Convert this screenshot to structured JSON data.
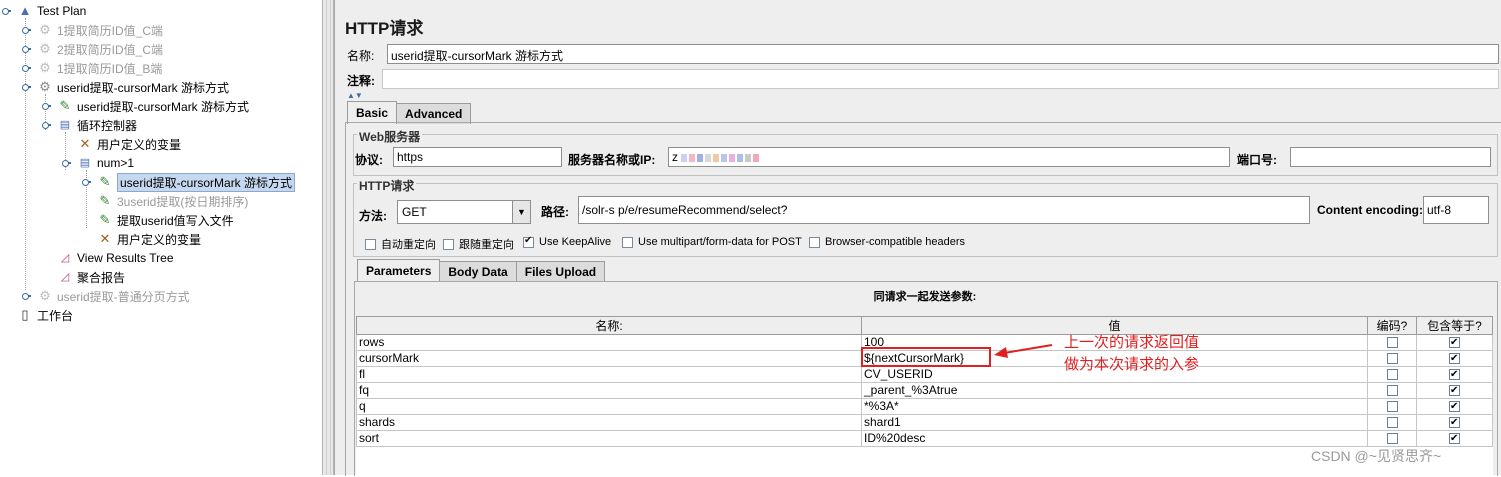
{
  "tree": {
    "nodes": [
      {
        "label": "Test Plan",
        "icon": "test-plan-icon",
        "disabled": false
      },
      {
        "label": "1提取简历ID值_C端",
        "icon": "thread-group-gear-icon",
        "disabled": true
      },
      {
        "label": "2提取简历ID值_C端",
        "icon": "thread-group-gear-icon",
        "disabled": true
      },
      {
        "label": "1提取简历ID值_B端",
        "icon": "thread-group-gear-icon",
        "disabled": true
      },
      {
        "label": "userid提取-cursorMark 游标方式",
        "icon": "thread-group-gear-icon",
        "disabled": false
      },
      {
        "label": "userid提取-cursorMark 游标方式",
        "icon": "sampler-pipette-icon",
        "disabled": false
      },
      {
        "label": "循环控制器",
        "icon": "loop-controller-icon",
        "disabled": false
      },
      {
        "label": "用户定义的变量",
        "icon": "config-tools-icon",
        "disabled": false
      },
      {
        "label": "num>1",
        "icon": "if-controller-icon",
        "disabled": false
      },
      {
        "label": "userid提取-cursorMark 游标方式",
        "icon": "sampler-pipette-icon",
        "disabled": false,
        "selected": true
      },
      {
        "label": "3userid提取(按日期排序)",
        "icon": "sampler-pipette-icon",
        "disabled": true
      },
      {
        "label": "提取userid值写入文件",
        "icon": "sampler-pipette-icon",
        "disabled": false
      },
      {
        "label": "用户定义的变量",
        "icon": "config-tools-icon",
        "disabled": false
      },
      {
        "label": "View Results Tree",
        "icon": "listener-graph-icon",
        "disabled": false
      },
      {
        "label": "聚合报告",
        "icon": "listener-graph-icon",
        "disabled": false
      },
      {
        "label": "userid提取-普通分页方式",
        "icon": "thread-group-gear-icon",
        "disabled": true
      },
      {
        "label": "工作台",
        "icon": "workbench-icon",
        "disabled": false
      }
    ]
  },
  "panel": {
    "title": "HTTP请求",
    "name_label": "名称:",
    "name_value": "userid提取-cursorMark 游标方式",
    "comment_label": "注释:",
    "comment_value": "",
    "tabs": [
      "Basic",
      "Advanced"
    ],
    "web_server": {
      "title": "Web服务器",
      "protocol_label": "协议:",
      "protocol_value": "https",
      "server_label": "服务器名称或IP:",
      "server_value": "z",
      "port_label": "端口号:",
      "port_value": ""
    },
    "http_request": {
      "title": "HTTP请求",
      "method_label": "方法:",
      "method_value": "GET",
      "path_label": "路径:",
      "path_value": "/solr-s  p/e/resumeRecommend/select?",
      "encoding_label": "Content encoding:",
      "encoding_value": "utf-8"
    },
    "options": [
      {
        "label": "自动重定向",
        "checked": false
      },
      {
        "label": "跟随重定向",
        "checked": false
      },
      {
        "label": "Use KeepAlive",
        "checked": true
      },
      {
        "label": "Use multipart/form-data for POST",
        "checked": false
      },
      {
        "label": "Browser-compatible headers",
        "checked": false
      }
    ],
    "sub_tabs": [
      "Parameters",
      "Body Data",
      "Files Upload"
    ],
    "params": {
      "caption": "同请求一起发送参数:",
      "headers": [
        "名称:",
        "值",
        "编码?",
        "包含等于?"
      ],
      "rows": [
        {
          "name": "rows",
          "value": "100",
          "encode": false,
          "include_equals": true
        },
        {
          "name": "cursorMark",
          "value": "${nextCursorMark}",
          "encode": false,
          "include_equals": true
        },
        {
          "name": "fl",
          "value": "CV_USERID",
          "encode": false,
          "include_equals": true
        },
        {
          "name": "fq",
          "value": "_parent_%3Atrue",
          "encode": false,
          "include_equals": true
        },
        {
          "name": "q",
          "value": "*%3A*",
          "encode": false,
          "include_equals": true
        },
        {
          "name": "shards",
          "value": "shard1",
          "encode": false,
          "include_equals": true
        },
        {
          "name": "sort",
          "value": "ID%20desc",
          "encode": false,
          "include_equals": true
        }
      ]
    }
  },
  "annotation": {
    "line1": "上一次的请求返回值",
    "line2": "做为本次请求的入参",
    "color": "#e02020"
  },
  "watermark": "CSDN @~见贤思齐~"
}
